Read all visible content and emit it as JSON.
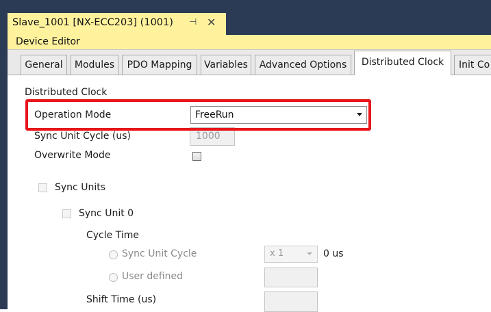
{
  "document_tab": {
    "title": "Slave_1001 [NX-ECC203] (1001)",
    "pin_glyph": "⊣",
    "close_glyph": "✕"
  },
  "editor": {
    "header": "Device Editor"
  },
  "tabs": [
    {
      "label": "General"
    },
    {
      "label": "Modules"
    },
    {
      "label": "PDO Mapping"
    },
    {
      "label": "Variables"
    },
    {
      "label": "Advanced Options"
    },
    {
      "label": "Distributed Clock"
    },
    {
      "label": "Init Co"
    }
  ],
  "distributed_clock": {
    "section_title": "Distributed Clock",
    "operation_mode": {
      "label": "Operation Mode",
      "value": "FreeRun"
    },
    "sync_unit_cycle": {
      "label": "Sync Unit Cycle (us)",
      "value": "1000"
    },
    "overwrite_mode": {
      "label": "Overwrite Mode",
      "checked": false
    },
    "sync_units": {
      "label": "Sync Units",
      "unit0": {
        "label": "Sync Unit 0",
        "cycle_time": {
          "label": "Cycle Time",
          "sync_unit_cycle_option": "Sync Unit Cycle",
          "multiplier": "x 1",
          "result": "0 us",
          "user_defined_option": "User defined"
        },
        "shift_time": {
          "label": "Shift Time (us)"
        }
      }
    }
  },
  "colors": {
    "title_bar": "#2b3a55",
    "active_tab": "#fff29d",
    "highlight": "#e8161b"
  }
}
